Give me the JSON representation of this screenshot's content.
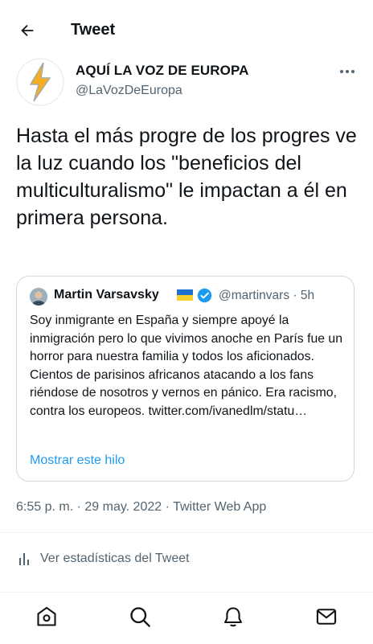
{
  "header": {
    "title": "Tweet"
  },
  "author": {
    "name": "AQUÍ LA VOZ DE EUROPA",
    "handle": "@LaVozDeEuropa"
  },
  "tweet": {
    "text": "Hasta el más progre de los progres ve la luz cuando los \"beneficios del multiculturalismo\" le impactan a él en primera persona."
  },
  "quote": {
    "name": "Martin Varsavsky",
    "handle": "@martinvars",
    "separator": "·",
    "time": "5h",
    "text": "Soy inmigrante en España y siempre apoyé la inmigración pero lo que vivimos anoche en París fue un horror para nuestra familia y todos los aficionados. Cientos de parisinos africanos atacando a los fans riéndose de nosotros y vernos en pánico. Era racismo, contra los europeos. twitter.com/ivanedlm/statu…",
    "show_thread": "Mostrar este hilo"
  },
  "meta": {
    "timestamp": "6:55 p. m. · 29 may. 2022 · Twitter Web App"
  },
  "stats": {
    "label": "Ver estadísticas del Tweet"
  },
  "nav": [
    "home-icon",
    "search-icon",
    "notifications-icon",
    "messages-icon"
  ],
  "colors": {
    "link": "#1d9bf0",
    "secondary": "#536471",
    "border": "#cfd9de",
    "avatar_bolt": "#f2b01e"
  }
}
